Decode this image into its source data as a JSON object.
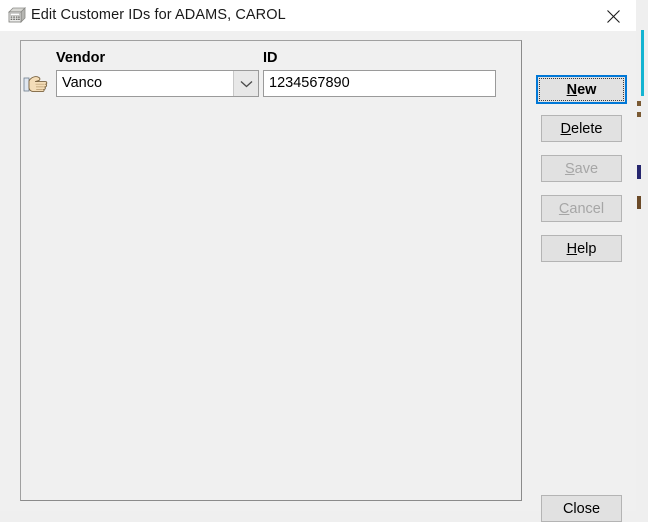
{
  "window": {
    "title": "Edit Customer IDs for ADAMS, CAROL",
    "icon": "calculator-icon",
    "close_glyph": "close-icon"
  },
  "form": {
    "columns": {
      "vendor_header": "Vendor",
      "id_header": "ID"
    },
    "row_indicator_icon": "pointing-hand-icon",
    "record": {
      "vendor": "Vanco",
      "id": "1234567890"
    },
    "vendor_dropdown_icon": "chevron-down-icon"
  },
  "buttons": {
    "new": {
      "label_prefix": "",
      "accel": "N",
      "label_suffix": "ew",
      "full": "New",
      "enabled": true,
      "default": true
    },
    "delete": {
      "label_prefix": "",
      "accel": "D",
      "label_suffix": "elete",
      "full": "Delete",
      "enabled": true,
      "default": false
    },
    "save": {
      "label_prefix": "",
      "accel": "S",
      "label_suffix": "ave",
      "full": "Save",
      "enabled": false,
      "default": false
    },
    "cancel": {
      "label_prefix": "",
      "accel": "C",
      "label_suffix": "ancel",
      "full": "Cancel",
      "enabled": false,
      "default": false
    },
    "help": {
      "label_prefix": "",
      "accel": "H",
      "label_suffix": "elp",
      "full": "Help",
      "enabled": true,
      "default": false
    },
    "close": {
      "label_prefix": "",
      "accel": "",
      "label_suffix": "",
      "full": "Close",
      "enabled": true,
      "default": false
    }
  },
  "colors": {
    "titlebar_bg": "#ffffff",
    "client_bg": "#f0f0f0",
    "button_face": "#e1e1e1",
    "default_button_border": "#0078d7",
    "disabled_text": "#a6a6a6",
    "field_bg": "#ffffff",
    "background_window_accent": "#14b4d2"
  }
}
